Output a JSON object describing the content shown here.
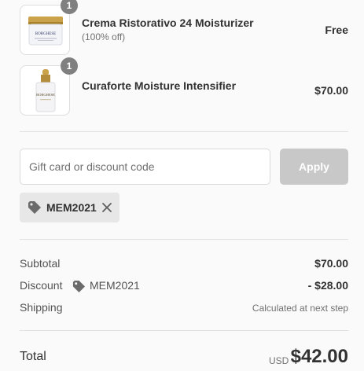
{
  "items": [
    {
      "quantity": "1",
      "name": "Crema Ristorativo 24 Moisturizer",
      "note": "(100% off)",
      "price": "Free",
      "image_icon": "jar-icon",
      "brand_text": "BORGHESE"
    },
    {
      "quantity": "1",
      "name": "Curaforte Moisture Intensifier",
      "price": "$70.00",
      "image_icon": "dropper-bottle-icon",
      "brand_text": "BORGHESE"
    }
  ],
  "discount_form": {
    "placeholder": "Gift card or discount code",
    "value": "",
    "apply_label": "Apply"
  },
  "applied_code": {
    "code": "MEM2021",
    "icon": "tag-icon",
    "remove_icon": "close-icon"
  },
  "summary": {
    "subtotal_label": "Subtotal",
    "subtotal_value": "$70.00",
    "discount_label": "Discount",
    "discount_code": "MEM2021",
    "discount_value": "- $28.00",
    "shipping_label": "Shipping",
    "shipping_value": "Calculated at next step"
  },
  "total": {
    "label": "Total",
    "currency": "USD",
    "amount": "$42.00"
  },
  "colors": {
    "background": "#fafafa",
    "badge": "#808080",
    "apply_disabled": "#c8c8c8",
    "chip": "#e7e7e7",
    "divider": "#e1e1e1",
    "gold_accent": "#c9a24a"
  }
}
